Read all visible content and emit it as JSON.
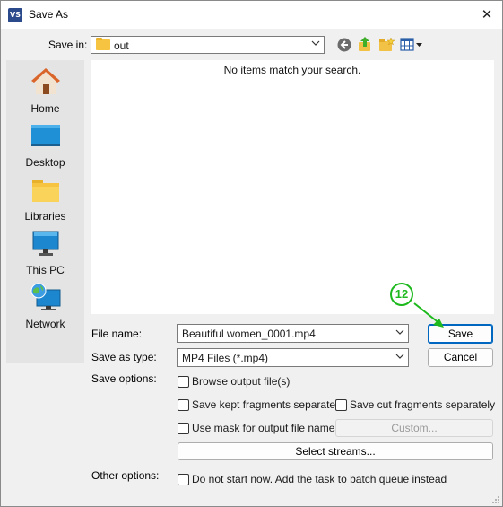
{
  "window": {
    "title": "Save As",
    "app_badge": "VS"
  },
  "toolbar": {
    "save_in_label": "Save in:",
    "save_in_value": "out",
    "icons": [
      "back-icon",
      "up-folder-icon",
      "new-folder-icon",
      "view-menu-icon"
    ]
  },
  "places": [
    {
      "label": "Home",
      "icon": "home-icon"
    },
    {
      "label": "Desktop",
      "icon": "desktop-icon"
    },
    {
      "label": "Libraries",
      "icon": "libraries-icon"
    },
    {
      "label": "This PC",
      "icon": "this-pc-icon"
    },
    {
      "label": "Network",
      "icon": "network-icon"
    }
  ],
  "file_list": {
    "empty_message": "No items match your search."
  },
  "form": {
    "file_name_label": "File name:",
    "file_name_value": "Beautiful women_0001.mp4",
    "save_type_label": "Save as type:",
    "save_type_value": "MP4 Files (*.mp4)",
    "save_options_label": "Save options:",
    "other_options_label": "Other options:"
  },
  "buttons": {
    "save": "Save",
    "cancel": "Cancel",
    "custom": "Custom...",
    "select_streams": "Select streams..."
  },
  "checkboxes": {
    "browse_output": "Browse output file(s)",
    "save_kept": "Save kept fragments separately",
    "save_cut": "Save cut fragments separately",
    "use_mask": "Use mask for output file names",
    "do_not_start": "Do not start now. Add the task to batch queue instead"
  },
  "annotation": {
    "step": "12",
    "color": "#1db91d"
  }
}
